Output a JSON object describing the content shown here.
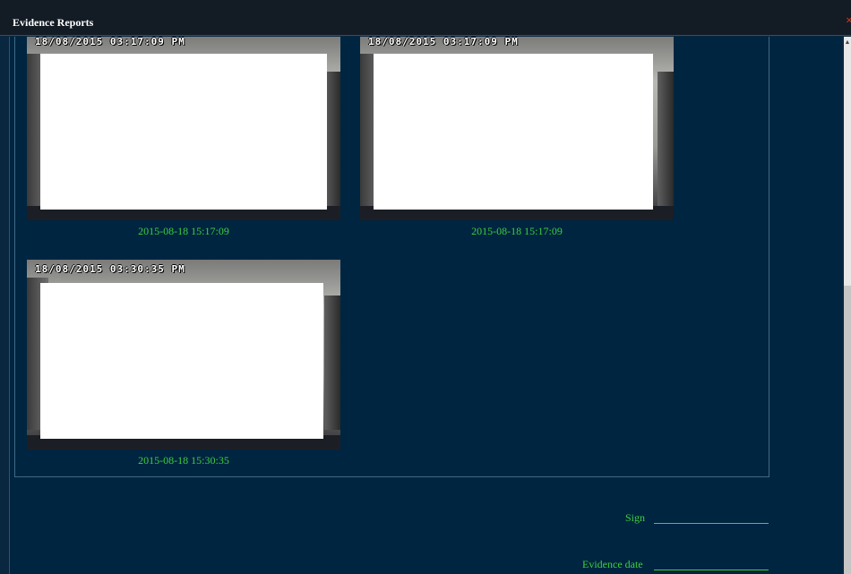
{
  "window": {
    "title": "Evidence Reports",
    "close_glyph": "×"
  },
  "evidence_images": [
    {
      "stamp": "18/08/2015 03:17:09 PM",
      "caption": "2015-08-18 15:17:09"
    },
    {
      "stamp": "18/08/2015 03:17:09 PM",
      "caption": "2015-08-18 15:17:09"
    },
    {
      "stamp": "18/08/2015 03:30:35 PM",
      "caption": "2015-08-18 15:30:35"
    }
  ],
  "footer": {
    "sign_label": "Sign",
    "evidence_date_label": "Evidence date"
  },
  "scrollbar": {
    "up_glyph": "▲"
  },
  "colors": {
    "background": "#002540",
    "caption_text": "#3ecf3e",
    "title_bar": "#131b24",
    "close": "#d0361f"
  }
}
